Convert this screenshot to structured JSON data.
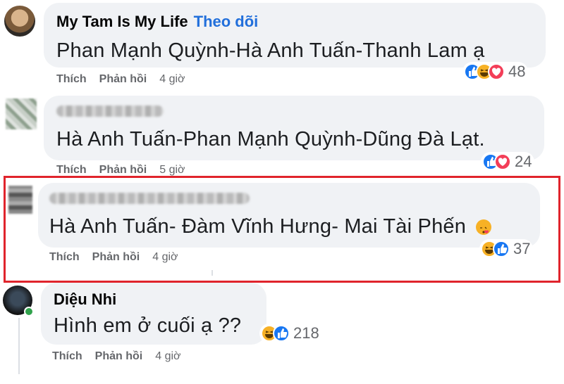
{
  "comments": [
    {
      "author": "My Tam Is My Life",
      "follow_label": "Theo dõi",
      "text": "Phan Mạnh Quỳnh-Hà Anh Tuấn-Thanh Lam ạ",
      "like_label": "Thích",
      "reply_label": "Phản hồi",
      "time": "4 giờ",
      "reaction_count": "48",
      "reaction_icons": [
        "like-icon",
        "haha-icon",
        "love-icon"
      ]
    },
    {
      "author": "",
      "text": "Hà Anh Tuấn-Phan Mạnh Quỳnh-Dũng Đà Lạt.",
      "like_label": "Thích",
      "reply_label": "Phản hồi",
      "time": "5 giờ",
      "reaction_count": "24",
      "reaction_icons": [
        "like-icon",
        "love-icon"
      ]
    },
    {
      "author": "",
      "text": "Hà Anh Tuấn- Đàm Vĩnh Hưng- Mai Tài Phến",
      "emoji": "winking-kiss-emoji",
      "like_label": "Thích",
      "reply_label": "Phản hồi",
      "time": "4 giờ",
      "reaction_count": "37",
      "reaction_icons": [
        "haha-icon",
        "like-icon"
      ]
    },
    {
      "author": "Diệu Nhi",
      "text": "Hình em ở cuối ạ ??",
      "like_label": "Thích",
      "reply_label": "Phản hồi",
      "time": "4 giờ",
      "reaction_count": "218",
      "reaction_icons": [
        "haha-icon",
        "like-icon"
      ]
    }
  ],
  "colors": {
    "bubble": "#f0f2f5",
    "link": "#216fdb",
    "highlight": "#e0242c",
    "like": "#1877f2",
    "love": "#f33e58",
    "haha": "#f7b125"
  }
}
